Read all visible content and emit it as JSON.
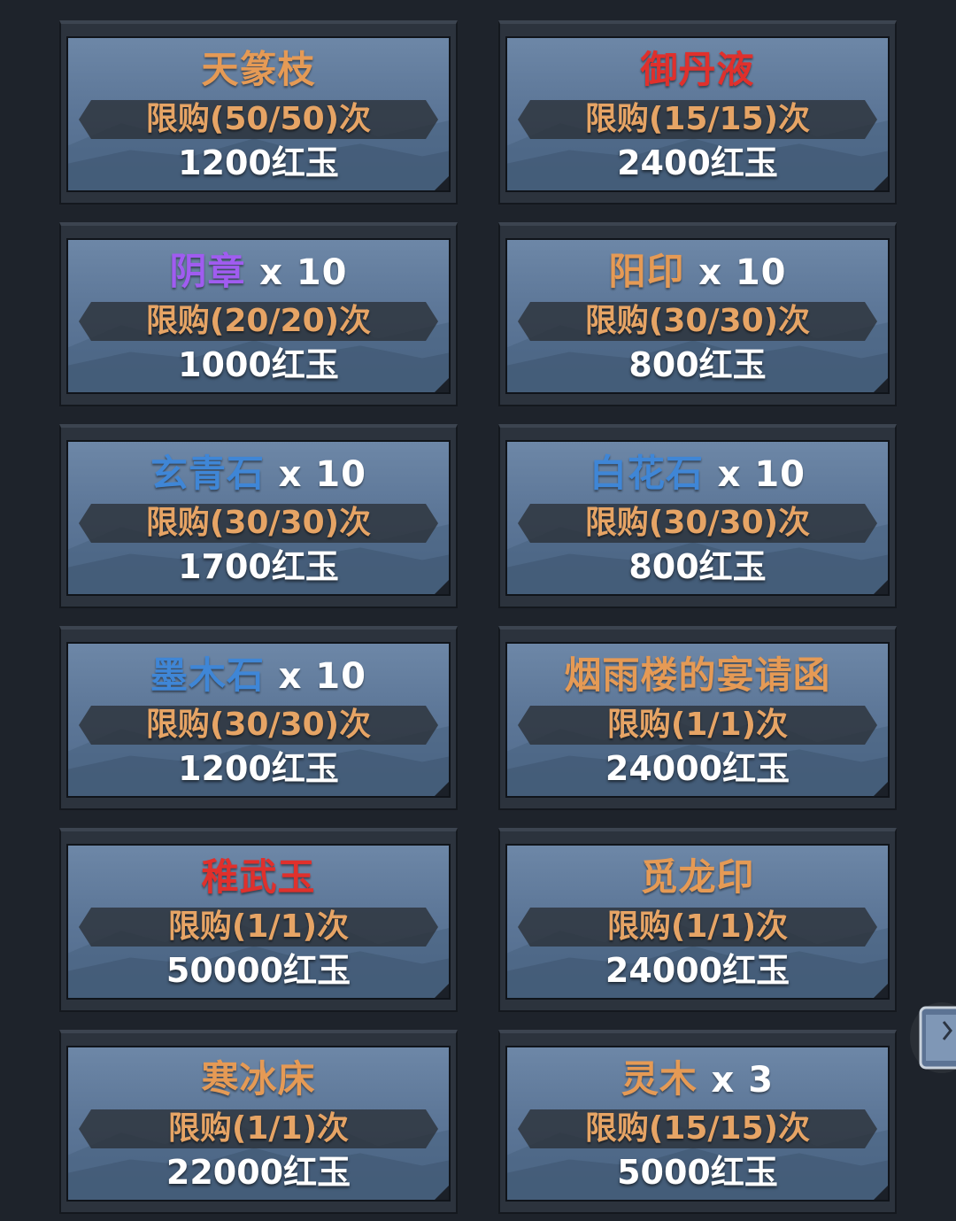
{
  "items": [
    {
      "name": "天篆枝",
      "qty": "",
      "name_color": "#e59a55",
      "limit": "限购(50/50)次",
      "price": "1200红玉"
    },
    {
      "name": "御丹液",
      "qty": "",
      "name_color": "#e0302c",
      "limit": "限购(15/15)次",
      "price": "2400红玉"
    },
    {
      "name": "阴章",
      "qty": "x 10",
      "name_color": "#a05cf0",
      "limit": "限购(20/20)次",
      "price": "1000红玉"
    },
    {
      "name": "阳印",
      "qty": "x 10",
      "name_color": "#e59a55",
      "limit": "限购(30/30)次",
      "price": "800红玉"
    },
    {
      "name": "玄青石",
      "qty": "x 10",
      "name_color": "#3f86d6",
      "limit": "限购(30/30)次",
      "price": "1700红玉"
    },
    {
      "name": "白花石",
      "qty": "x 10",
      "name_color": "#3f86d6",
      "limit": "限购(30/30)次",
      "price": "800红玉"
    },
    {
      "name": "墨木石",
      "qty": "x 10",
      "name_color": "#3f86d6",
      "limit": "限购(30/30)次",
      "price": "1200红玉"
    },
    {
      "name": "烟雨楼的宴请函",
      "qty": "",
      "name_color": "#e59a55",
      "limit": "限购(1/1)次",
      "price": "24000红玉"
    },
    {
      "name": "稚武玉",
      "qty": "",
      "name_color": "#e0302c",
      "limit": "限购(1/1)次",
      "price": "50000红玉"
    },
    {
      "name": "觅龙印",
      "qty": "",
      "name_color": "#e59a55",
      "limit": "限购(1/1)次",
      "price": "24000红玉"
    },
    {
      "name": "寒冰床",
      "qty": "",
      "name_color": "#e59a55",
      "limit": "限购(1/1)次",
      "price": "22000红玉"
    },
    {
      "name": "灵木",
      "qty": "x 3",
      "name_color": "#e59a55",
      "limit": "限购(15/15)次",
      "price": "5000红玉"
    }
  ]
}
